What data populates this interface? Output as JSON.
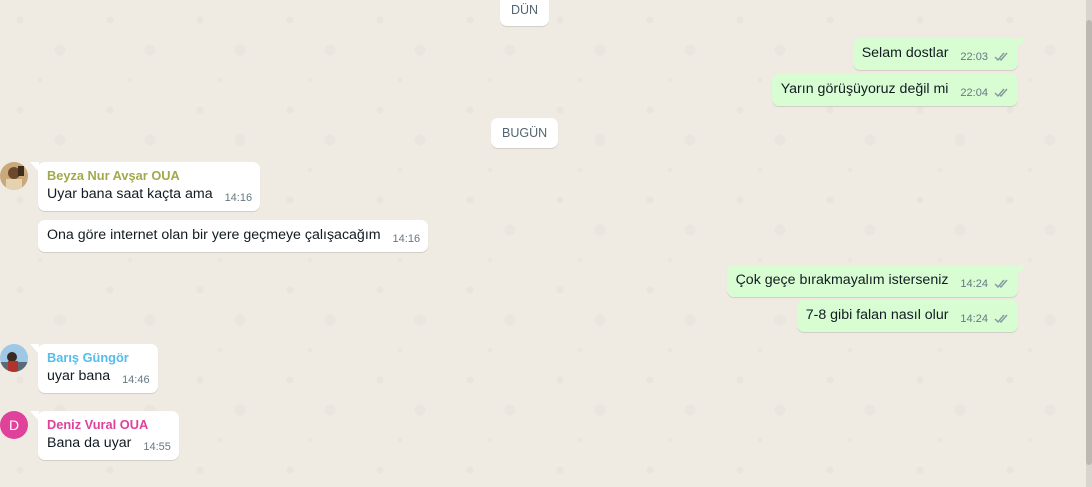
{
  "dates": {
    "yesterday": "DÜN",
    "today": "BUGÜN"
  },
  "colors": {
    "chat_background": "#efeae2",
    "outgoing_bubble": "#d9fdd3",
    "incoming_bubble": "#ffffff",
    "read_ticks": "#8696a0",
    "sender_beyza": "#a3a94a",
    "sender_baris": "#53bdeb",
    "sender_deniz": "#e0419a"
  },
  "messages": [
    {
      "direction": "out",
      "text": "Selam dostlar",
      "time": "22:03",
      "status": "read"
    },
    {
      "direction": "out",
      "text": "Yarın görüşüyoruz değil mi",
      "time": "22:04",
      "status": "read"
    },
    {
      "direction": "in",
      "sender": "Beyza Nur Avşar OUA",
      "text": "Uyar bana saat kaçta ama",
      "time": "14:16"
    },
    {
      "direction": "in",
      "text": "Ona göre internet olan bir yere geçmeye çalışacağım",
      "time": "14:16"
    },
    {
      "direction": "out",
      "text": "Çok geçe bırakmayalım isterseniz",
      "time": "14:24",
      "status": "read"
    },
    {
      "direction": "out",
      "text": "7-8 gibi falan nasıl olur",
      "time": "14:24",
      "status": "read"
    },
    {
      "direction": "in",
      "sender": "Barış Güngör",
      "text": "uyar bana",
      "time": "14:46"
    },
    {
      "direction": "in",
      "sender": "Deniz Vural OUA",
      "avatar_letter": "D",
      "text": "Bana da uyar",
      "time": "14:55"
    }
  ],
  "icons": {
    "read_receipt": "double-check-icon"
  }
}
